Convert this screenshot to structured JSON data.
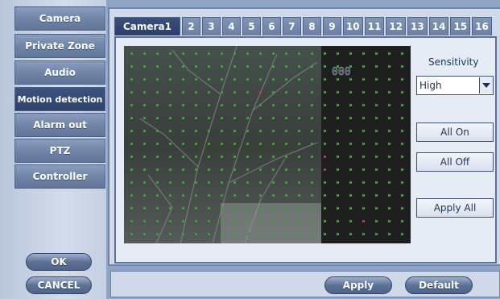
{
  "sidebar": {
    "items": [
      {
        "label": "Camera"
      },
      {
        "label": "Private Zone"
      },
      {
        "label": "Audio"
      },
      {
        "label": "Motion detection"
      },
      {
        "label": "Alarm out"
      },
      {
        "label": "PTZ"
      },
      {
        "label": "Controller"
      }
    ],
    "active_index": 3,
    "ok_label": "OK",
    "cancel_label": "CANCEL"
  },
  "tabs": [
    "Camera1",
    "2",
    "3",
    "4",
    "5",
    "6",
    "7",
    "8",
    "9",
    "10",
    "11",
    "12",
    "13",
    "14",
    "15",
    "16"
  ],
  "active_tab": 0,
  "video": {
    "timestamp_text": "000",
    "grid_colors": {
      "normal": "#2ea82e",
      "active": "#c43a3a"
    }
  },
  "controls": {
    "sensitivity_label": "Sensitivity",
    "sensitivity_value": "High",
    "all_on_label": "All On",
    "all_off_label": "All Off",
    "apply_all_label": "Apply All"
  },
  "footer": {
    "apply_label": "Apply",
    "default_label": "Default"
  },
  "colors": {
    "accent_dark": "#2c416c",
    "panel": "#cfd9ea"
  }
}
